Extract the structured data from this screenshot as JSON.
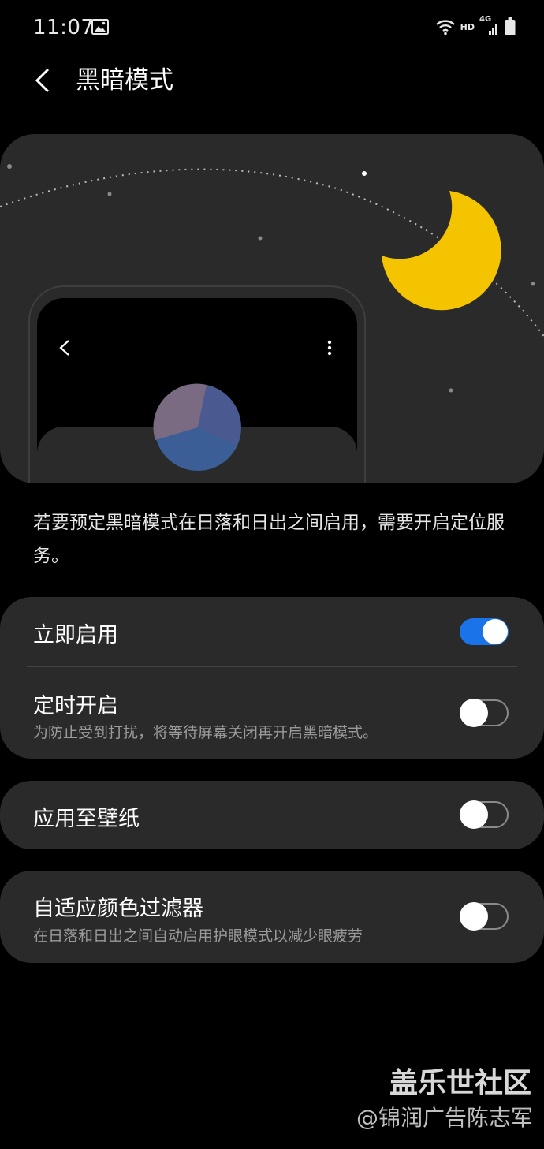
{
  "status_bar": {
    "time": "11:07",
    "gallery_icon": "image-icon",
    "wifi_icon": "wifi-icon",
    "network_label": "HD",
    "network_type": "4G",
    "signal_icon": "signal-icon",
    "battery_icon": "battery-icon"
  },
  "header": {
    "back_icon": "chevron-left-icon",
    "title": "黑暗模式"
  },
  "illustration": {
    "moon_color": "#f5c400",
    "preview_phone": {
      "back_icon": "chevron-left-icon",
      "more_icon": "more-vertical-icon"
    }
  },
  "description": "若要预定黑暗模式在日落和日出之间启用，需要开启定位服务。",
  "settings": {
    "turn_on_now": {
      "label": "立即启用",
      "enabled": true
    },
    "scheduled": {
      "label": "定时开启",
      "subtitle": "为防止受到打扰，将等待屏幕关闭再开启黑暗模式。",
      "enabled": false
    },
    "apply_wallpaper": {
      "label": "应用至壁纸",
      "enabled": false
    },
    "adaptive_filter": {
      "label": "自适应颜色过滤器",
      "subtitle": "在日落和日出之间自动启用护眼模式以减少眼疲劳",
      "enabled": false
    }
  },
  "colors": {
    "background": "#000000",
    "card": "#2a2a2a",
    "accent": "#1a73e8",
    "moon": "#f5c400"
  },
  "watermark": {
    "line1": "盖乐世社区",
    "line2": "@锦润广告陈志军"
  }
}
